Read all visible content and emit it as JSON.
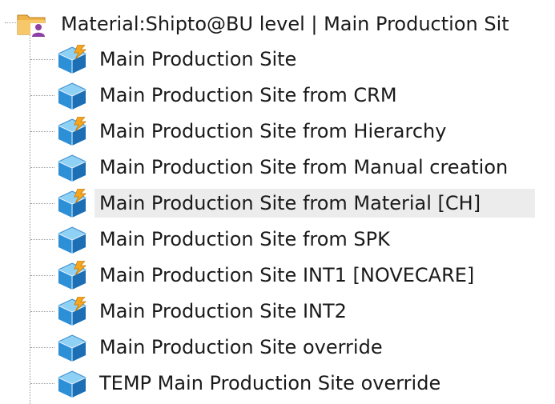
{
  "tree": {
    "root": {
      "label": "Material:Shipto@BU level | Main Production Sit",
      "icon": "folder-user-icon"
    },
    "items": [
      {
        "label": "Main Production Site",
        "icon": "cube-lightning-icon"
      },
      {
        "label": "Main Production Site from CRM",
        "icon": "cube-icon"
      },
      {
        "label": "Main Production Site from Hierarchy",
        "icon": "cube-lightning-icon"
      },
      {
        "label": "Main Production Site from Manual creation",
        "icon": "cube-icon"
      },
      {
        "label": "Main Production Site from Material [CH]",
        "icon": "cube-lightning-icon",
        "selected": true
      },
      {
        "label": "Main Production Site from SPK",
        "icon": "cube-icon"
      },
      {
        "label": "Main Production Site INT1 [NOVECARE]",
        "icon": "cube-lightning-icon"
      },
      {
        "label": "Main Production Site INT2",
        "icon": "cube-lightning-icon"
      },
      {
        "label": "Main Production Site override",
        "icon": "cube-icon"
      },
      {
        "label": "TEMP Main Production Site override",
        "icon": "cube-icon"
      }
    ]
  },
  "colors": {
    "cube_top": "#8fd0f5",
    "cube_left": "#2d8fd6",
    "cube_right": "#1c6fb4",
    "lightning": "#f5a623",
    "folder": "#f0b34a",
    "selection": "#ececec"
  }
}
